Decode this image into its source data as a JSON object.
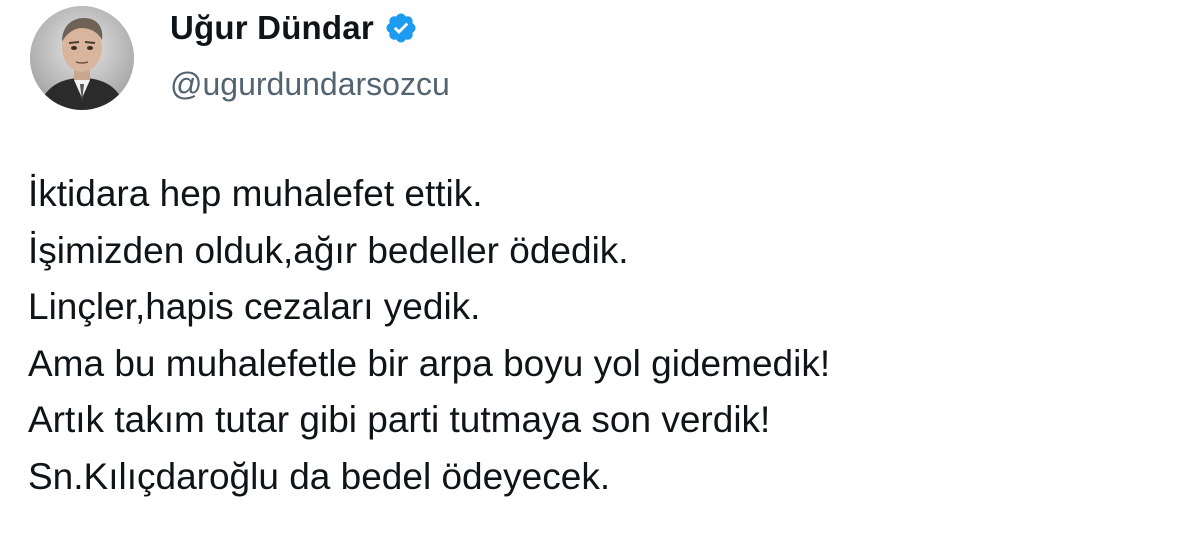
{
  "author": {
    "display_name": "Uğur Dündar",
    "handle": "@ugurdundarsozcu",
    "verified_badge": "verified-badge-icon",
    "avatar": "profile-avatar"
  },
  "tweet": {
    "lines": [
      "İktidara hep muhalefet ettik.",
      "İşimizden olduk,ağır bedeller ödedik.",
      "Linçler,hapis cezaları yedik.",
      "Ama bu muhalefetle bir arpa boyu yol gidemedik!",
      "Artık takım tutar gibi parti tutmaya son verdik!",
      "Sn.Kılıçdaroğlu da bedel ödeyecek."
    ]
  },
  "colors": {
    "verified_blue": "#1d9bf0",
    "text": "#0f1419",
    "secondary": "#536471"
  }
}
